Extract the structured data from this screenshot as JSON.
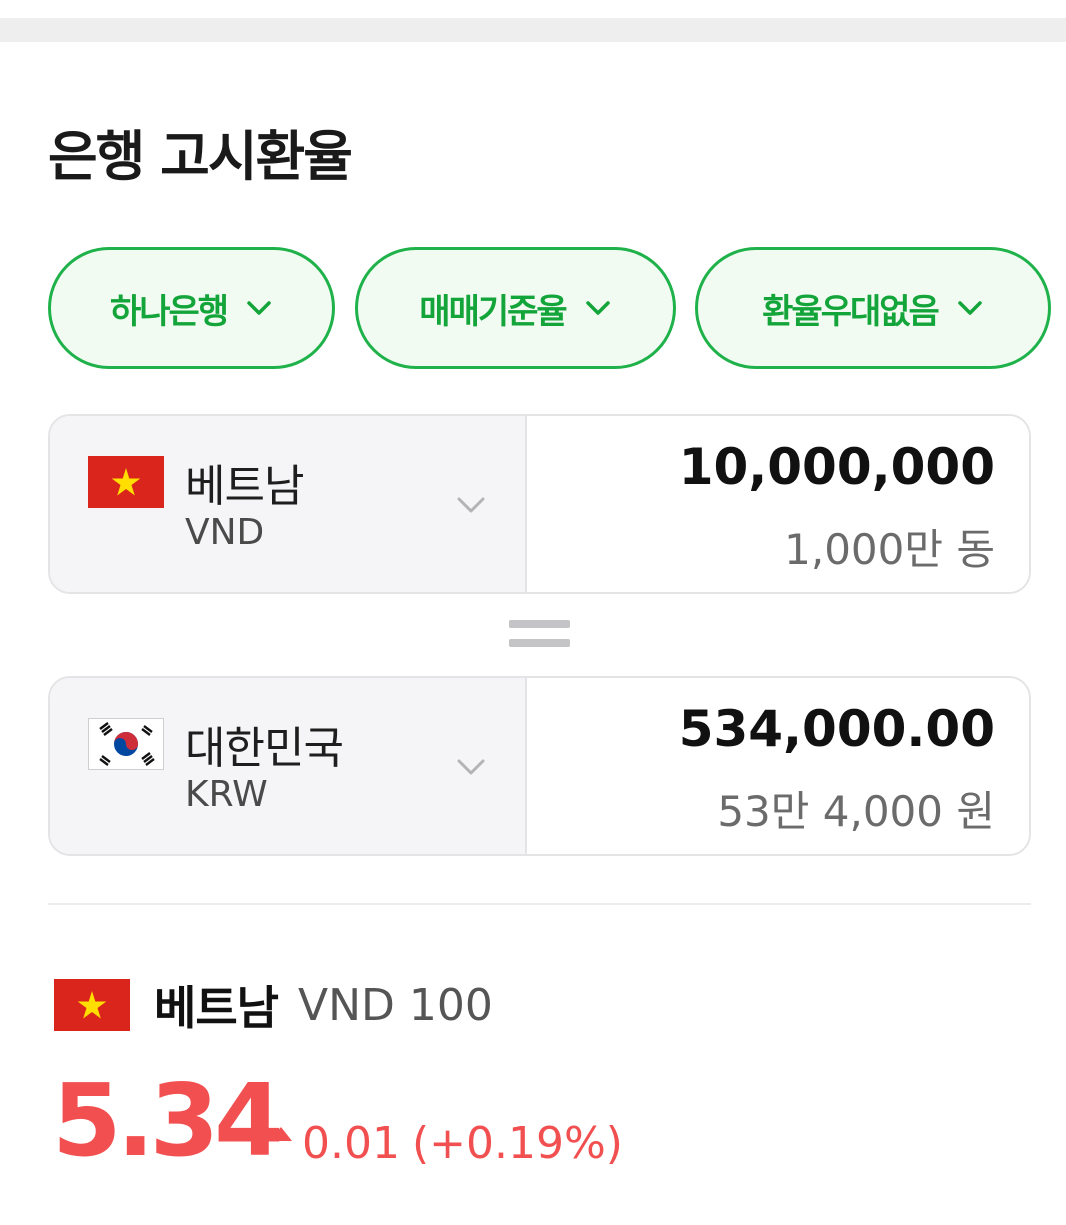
{
  "header": {
    "title": "은행 고시환율"
  },
  "filters": {
    "bank": "하나은행",
    "rate_type": "매매기준율",
    "preference": "환율우대없음"
  },
  "converter": {
    "from": {
      "country": "베트남",
      "code": "VND",
      "amount": "10,000,000",
      "amount_text": "1,000만 동",
      "flag": "vietnam-flag"
    },
    "to": {
      "country": "대한민국",
      "code": "KRW",
      "amount": "534,000.00",
      "amount_text": "53만 4,000 원",
      "flag": "south-korea-flag"
    }
  },
  "rate": {
    "country": "베트남",
    "unit": "VND 100",
    "value": "5.34",
    "change": "0.01",
    "change_pct": "(+0.19%)",
    "direction": "up",
    "color": "#f25050"
  },
  "colors": {
    "accent": "#13a43a",
    "chip_bg": "#f1fbf2",
    "up": "#f25050"
  }
}
